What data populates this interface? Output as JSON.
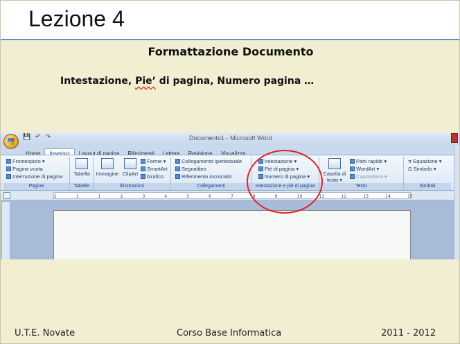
{
  "slide": {
    "title": "Lezione 4",
    "subtitle": "Formattazione Documento",
    "topic_line_a": "Intestazione, ",
    "topic_word_squig": "Pie’",
    "topic_line_b": " di pagina, Numero pagina …"
  },
  "footer": {
    "left": "U.T.E. Novate",
    "center": "Corso Base Informatica",
    "right": "2011 - 2012"
  },
  "word": {
    "window_title": "Documento1 - Microsoft Word",
    "quick_access": [
      "💾",
      "↶",
      "↷"
    ],
    "tabs": [
      "Home",
      "Inserisci",
      "Layout di pagina",
      "Riferimenti",
      "Lettere",
      "Revisione",
      "Visualizza"
    ],
    "active_tab": "Inserisci",
    "groups": {
      "pagine": {
        "name": "Pagine",
        "items": [
          "Frontespizio ▾",
          "Pagina vuota",
          "Interruzione di pagina"
        ]
      },
      "tabelle": {
        "name": "Tabelle",
        "items": [
          "Tabella"
        ]
      },
      "illustrazioni": {
        "name": "Illustrazioni",
        "items": [
          "Immagine",
          "ClipArt",
          "Forme ▾",
          "SmartArt",
          "Grafico"
        ]
      },
      "collegamenti": {
        "name": "Collegamenti",
        "items": [
          "Collegamento ipertestuale",
          "Segnalibro",
          "Riferimento incrociato"
        ]
      },
      "intestazione": {
        "name": "Intestazione e piè di pagina",
        "items": [
          "Intestazione ▾",
          "Piè di pagina ▾",
          "Numero di pagina ▾"
        ]
      },
      "testo": {
        "name": "Testo",
        "items": [
          "Casella di testo ▾",
          "Parti rapide ▾",
          "WordArt ▾",
          "Capolettera ▾"
        ]
      },
      "simboli": {
        "name": "Simboli",
        "items": [
          "π Equazione ▾",
          "Ω Simbolo ▾"
        ]
      }
    },
    "ruler_numbers": [
      "2",
      "1",
      "1",
      "2",
      "3",
      "4",
      "5",
      "6",
      "7",
      "8",
      "9",
      "10",
      "11",
      "12",
      "13",
      "14",
      "15"
    ]
  },
  "colors": {
    "slide_bg": "#f1eed2",
    "title_rule": "#5b8fd4",
    "highlight_circle": "#e0202a"
  }
}
